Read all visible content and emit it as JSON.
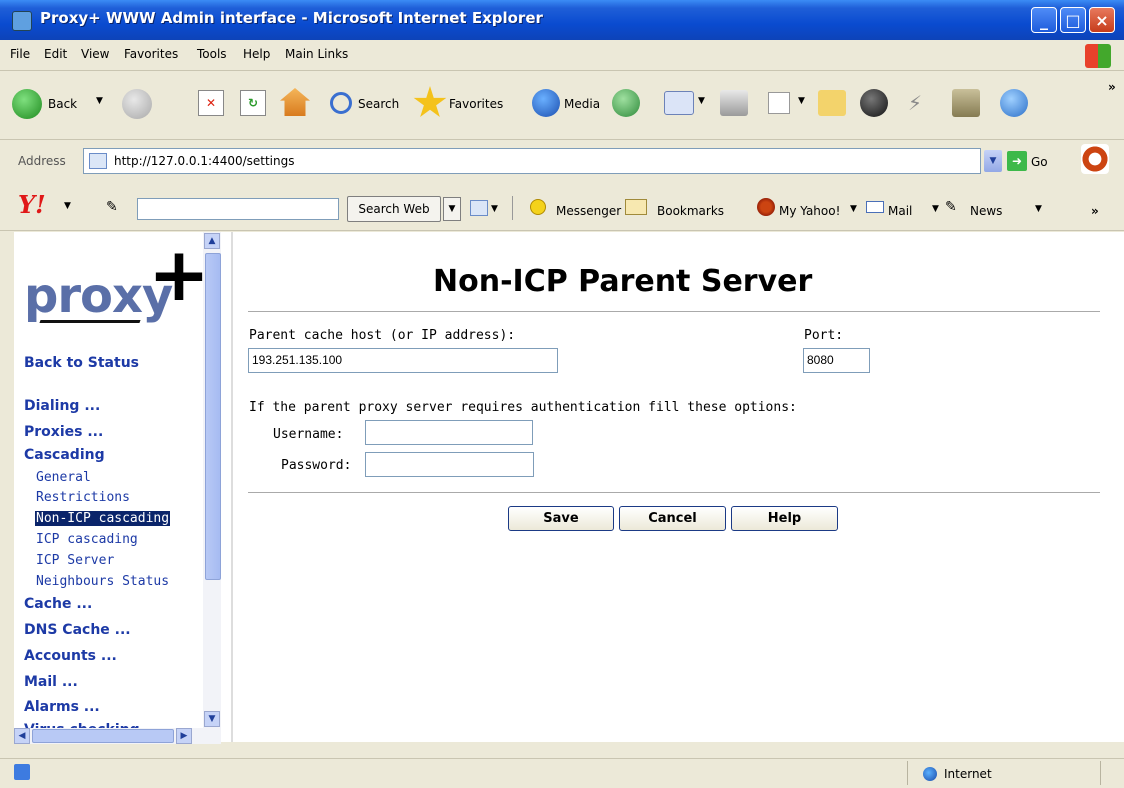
{
  "window": {
    "title": "Proxy+ WWW Admin interface - Microsoft Internet Explorer",
    "minimize": "_",
    "maximize": "□",
    "close": "×"
  },
  "menu": [
    "File",
    "Edit",
    "View",
    "Favorites",
    "Tools",
    "Help",
    "Main Links"
  ],
  "toolbar": {
    "back": "Back",
    "search": "Search",
    "favorites": "Favorites",
    "media": "Media",
    "overflow": "»"
  },
  "address": {
    "label": "Address",
    "url": "http://127.0.0.1:4400/settings",
    "go": "Go"
  },
  "yahoo": {
    "logo": "Y!",
    "search_button": "Search Web",
    "messenger": "Messenger",
    "bookmarks": "Bookmarks",
    "my_yahoo": "My Yahoo!",
    "mail": "Mail",
    "news": "News",
    "overflow": "»"
  },
  "sidebar": {
    "logo_text": "proxy",
    "logo_plus": "+",
    "back_to_status": "Back to Status",
    "items": [
      {
        "label": "Dialing ..."
      },
      {
        "label": "Proxies ..."
      },
      {
        "label": "Cascading"
      },
      {
        "label": "General"
      },
      {
        "label": "Restrictions"
      },
      {
        "label": "Non-ICP cascading"
      },
      {
        "label": "ICP cascading"
      },
      {
        "label": "ICP Server"
      },
      {
        "label": "Neighbours Status"
      },
      {
        "label": "Cache ..."
      },
      {
        "label": "DNS Cache ..."
      },
      {
        "label": "Accounts ..."
      },
      {
        "label": "Mail ..."
      },
      {
        "label": "Alarms ..."
      },
      {
        "label": "Virus checking"
      }
    ]
  },
  "form": {
    "title": "Non-ICP Parent Server",
    "host_label": "Parent cache host (or IP address):",
    "host_value": "193.251.135.100",
    "port_label": "Port:",
    "port_value": "8080",
    "auth_note": "If the parent proxy server requires authentication fill these options:",
    "username_label": "Username:",
    "username_value": "",
    "password_label": "Password:",
    "password_value": "",
    "save": "Save",
    "cancel": "Cancel",
    "help": "Help"
  },
  "status": {
    "zone": "Internet"
  },
  "colors": {
    "link": "#1d3aa6",
    "selected_bg": "#0a246a",
    "titlebar": "#0a4bd0"
  }
}
